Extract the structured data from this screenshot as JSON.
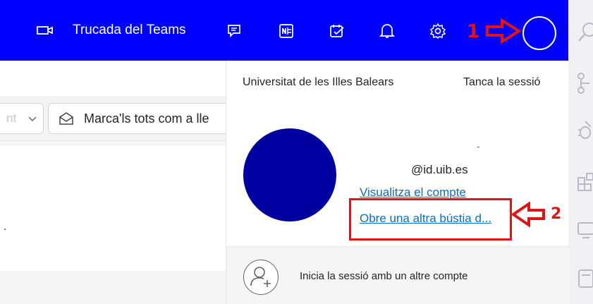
{
  "topbar": {
    "meeting_label": "Trucada del Teams",
    "icons": [
      "video-icon",
      "teams-chat-icon",
      "onenote-icon",
      "todo-icon",
      "bell-icon",
      "gear-icon",
      "help-icon",
      "avatar"
    ],
    "color": "#0000ff"
  },
  "annotations": {
    "step1": "1",
    "step2": "2",
    "color": "#e11414"
  },
  "mail": {
    "partial_left": "nt",
    "mark_all_read": "Marca'ls tots com a lle"
  },
  "account_panel": {
    "organization": "Universitat de les Illes Balears",
    "sign_out": "Tanca la sessió",
    "name_dash": "-",
    "email": "@id.uib.es",
    "view_account": "Visualitza el compte",
    "open_other_mailbox": "Obre una altra bústia d...",
    "sign_in_other": "Inicia la sessió amb un altre compte",
    "avatar_color": "#0000a0"
  }
}
